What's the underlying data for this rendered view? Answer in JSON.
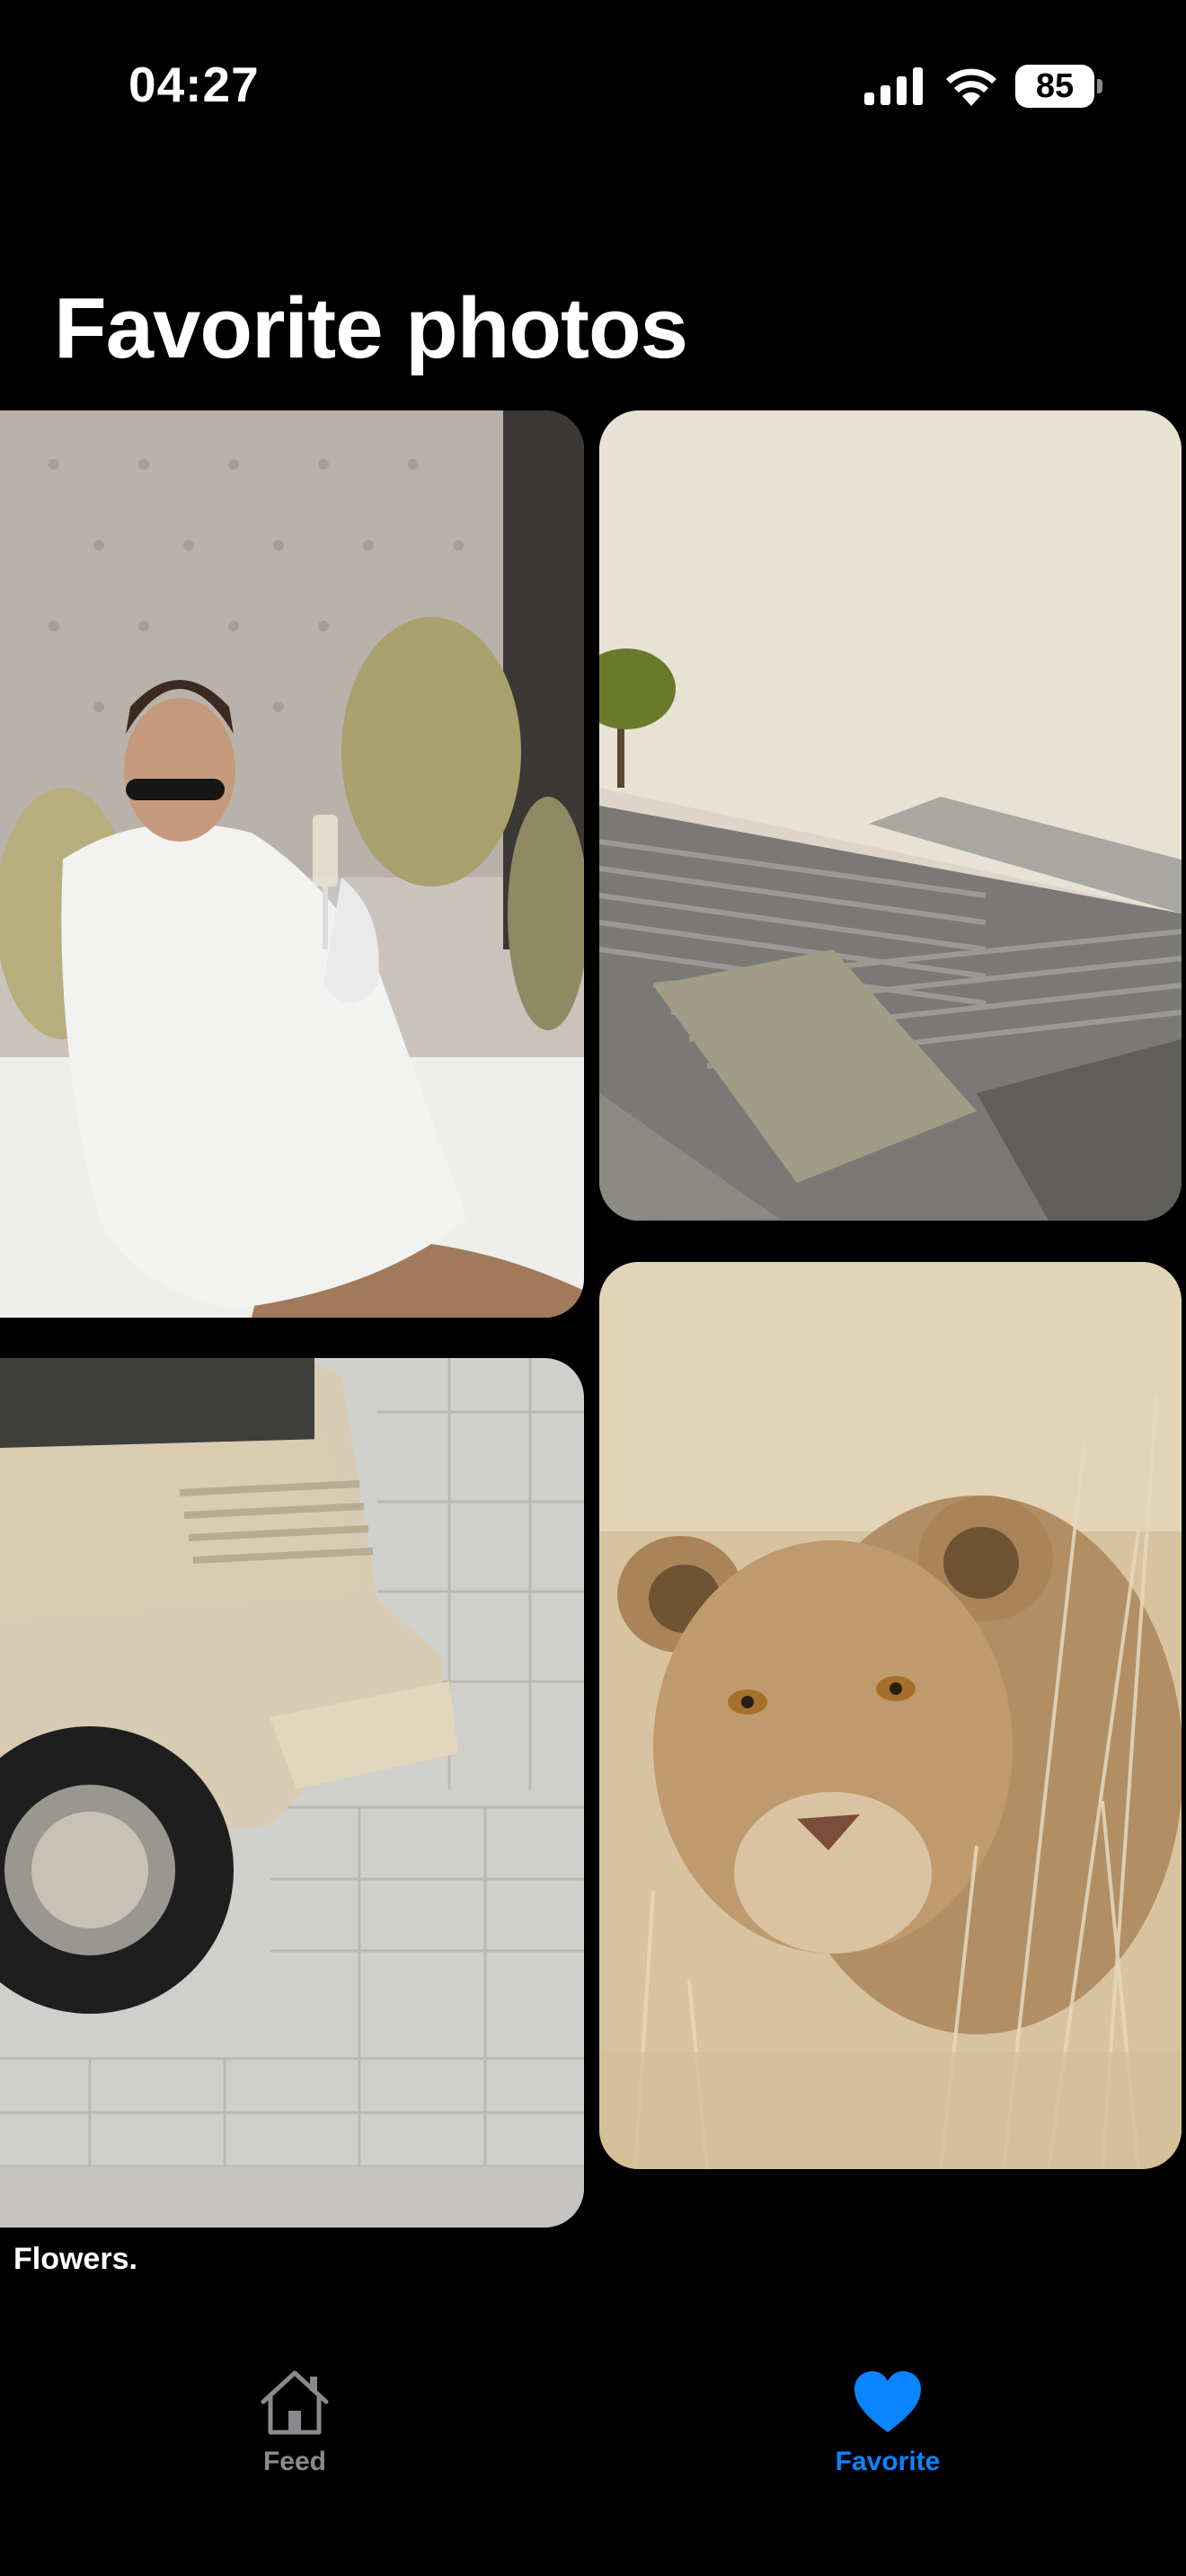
{
  "status_bar": {
    "time": "04:27",
    "battery_level": "85",
    "icons": [
      "signal-icon",
      "wifi-icon",
      "battery-icon"
    ]
  },
  "page": {
    "title": "Favorite photos"
  },
  "photos": [
    {
      "subject": "woman-in-bathrobe-photo"
    },
    {
      "subject": "stairs-architecture-photo"
    },
    {
      "subject": "vintage-car-photo"
    },
    {
      "subject": "lion-cub-photo"
    }
  ],
  "caption": "Flowers.",
  "tab_bar": {
    "tabs": [
      {
        "label": "Feed",
        "icon": "house-icon",
        "selected": false
      },
      {
        "label": "Favorite",
        "icon": "heart-icon",
        "selected": true
      }
    ]
  },
  "colors": {
    "background": "#000000",
    "accent": "#0a84ff",
    "inactive": "#8a8a8e",
    "text": "#ffffff"
  }
}
